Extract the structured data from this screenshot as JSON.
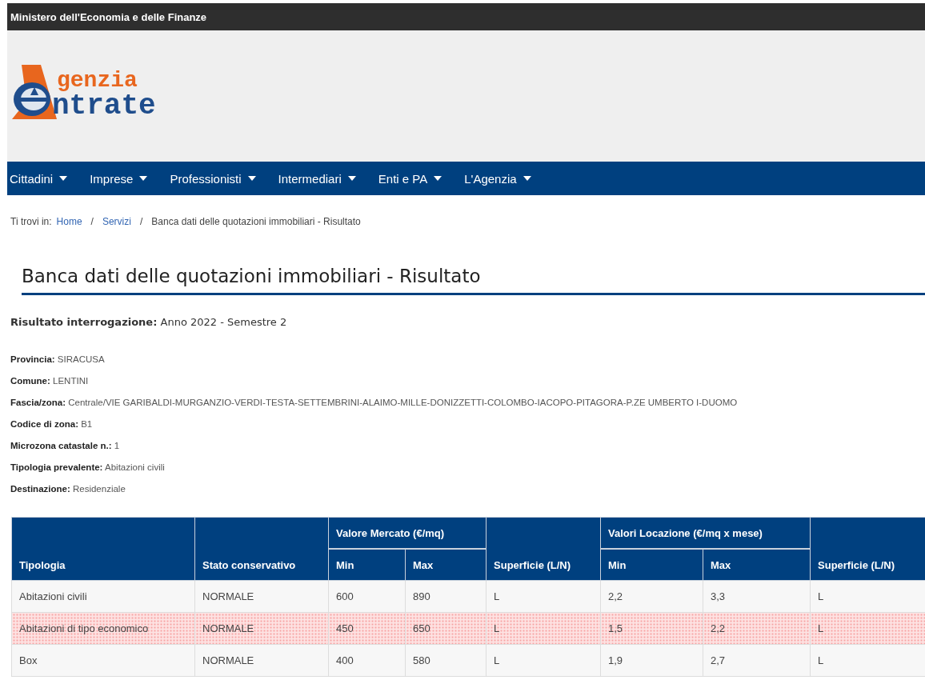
{
  "top_bar": {
    "title": "Ministero dell'Economia e delle Finanze"
  },
  "logo": {
    "line_1": "genzia",
    "line_2": "ntrate"
  },
  "nav": [
    {
      "label": "Cittadini"
    },
    {
      "label": "Imprese"
    },
    {
      "label": "Professionisti"
    },
    {
      "label": "Intermediari"
    },
    {
      "label": "Enti e PA"
    },
    {
      "label": "L'Agenzia"
    }
  ],
  "breadcrumb": {
    "prefix": "Ti trovi in:",
    "links": [
      "Home",
      "Servizi"
    ],
    "separator": "/",
    "current": "Banca dati delle quotazioni immobiliari - Risultato"
  },
  "page_title": "Banca dati delle quotazioni immobiliari - Risultato",
  "result": {
    "label": "Risultato interrogazione:",
    "value": "Anno 2022 - Semestre 2"
  },
  "details": [
    {
      "label": "Provincia:",
      "value": "SIRACUSA"
    },
    {
      "label": "Comune:",
      "value": "LENTINI"
    },
    {
      "label": "Fascia/zona:",
      "value": "Centrale/VIE GARIBALDI-MURGANZIO-VERDI-TESTA-SETTEMBRINI-ALAIMO-MILLE-DONIZZETTI-COLOMBO-IACOPO-PITAGORA-P.ZE UMBERTO I-DUOMO"
    },
    {
      "label": "Codice di zona:",
      "value": "B1"
    },
    {
      "label": "Microzona catastale n.:",
      "value": "1"
    },
    {
      "label": "Tipologia prevalente:",
      "value": "Abitazioni civili"
    },
    {
      "label": "Destinazione:",
      "value": "Residenziale"
    }
  ],
  "table": {
    "groups": [
      "Valore Mercato (€/mq)",
      "Valori Locazione (€/mq x mese)"
    ],
    "columns": [
      "Tipologia",
      "Stato conservativo",
      "Min",
      "Max",
      "Superficie (L/N)",
      "Min",
      "Max",
      "Superficie (L/N)"
    ],
    "rows": [
      {
        "cells": [
          "Abitazioni civili",
          "NORMALE",
          "600",
          "890",
          "L",
          "2,2",
          "3,3",
          "L"
        ],
        "highlighted": false
      },
      {
        "cells": [
          "Abitazioni di tipo economico",
          "NORMALE",
          "450",
          "650",
          "L",
          "1,5",
          "2,2",
          "L"
        ],
        "highlighted": true
      },
      {
        "cells": [
          "Box",
          "NORMALE",
          "400",
          "580",
          "L",
          "1,9",
          "2,7",
          "L"
        ],
        "highlighted": false
      }
    ]
  }
}
